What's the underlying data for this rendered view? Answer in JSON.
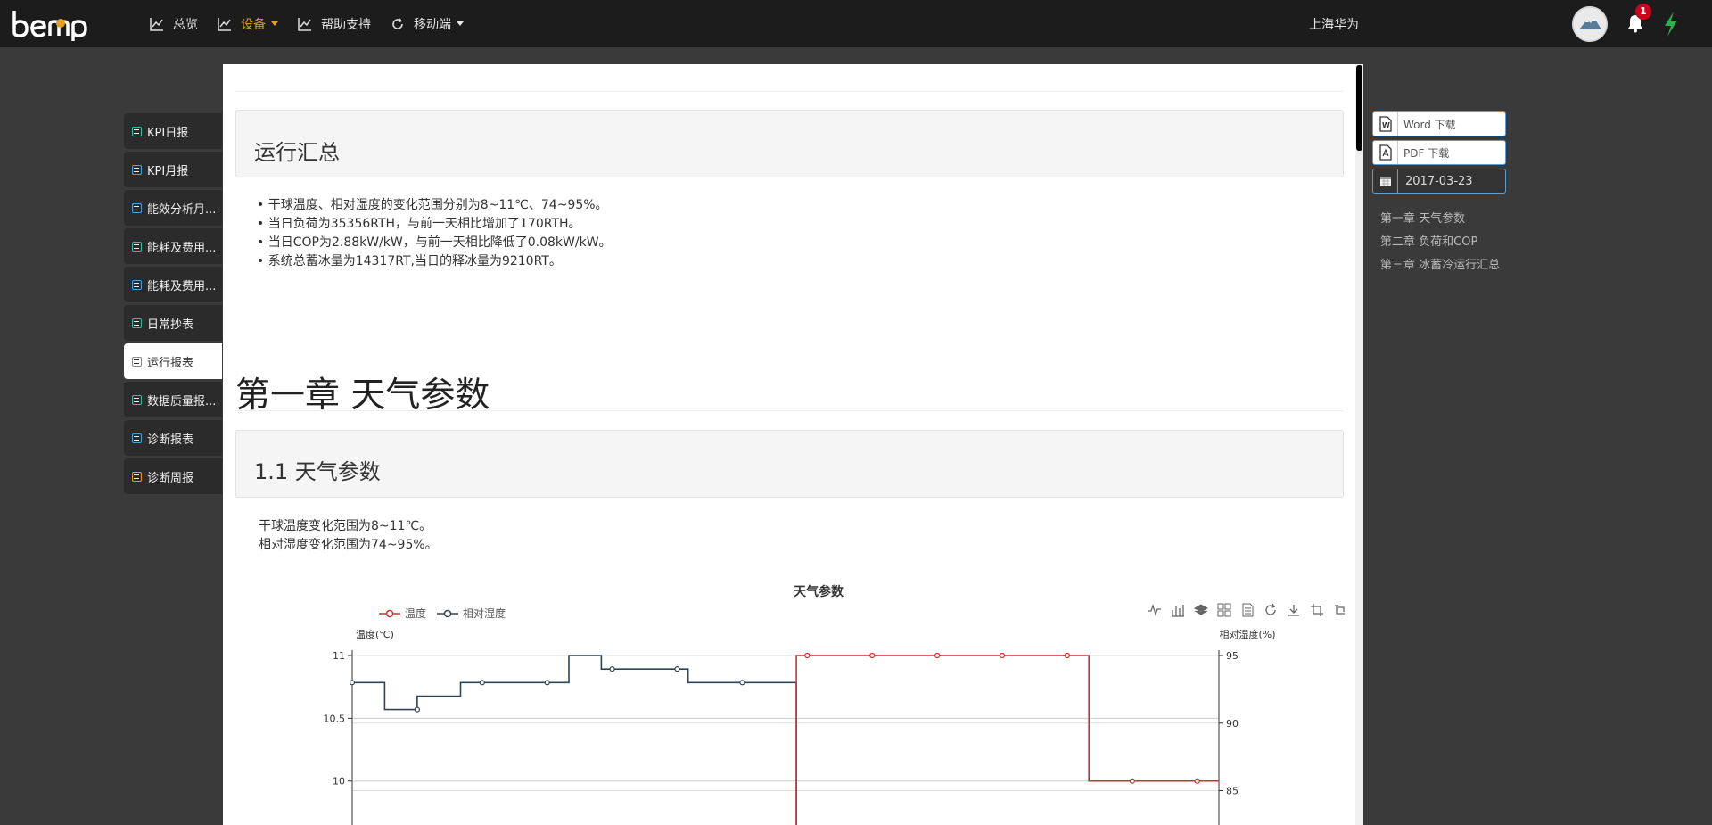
{
  "header": {
    "logo_text": "bemp",
    "nav": [
      {
        "label": "总览",
        "icon": "line-chart-icon",
        "active": false
      },
      {
        "label": "设备",
        "icon": "line-chart-icon",
        "active": true,
        "dropdown": true
      },
      {
        "label": "帮助支持",
        "icon": "line-chart-icon",
        "active": false
      },
      {
        "label": "移动端",
        "icon": "refresh-icon",
        "active": false,
        "dropdown": true
      }
    ],
    "org_name": "上海华为",
    "notification_count": "1"
  },
  "sidebar": {
    "items": [
      {
        "label": "KPI日报",
        "icon": "edit-icon"
      },
      {
        "label": "KPI月报",
        "icon": "list-icon"
      },
      {
        "label": "能效分析月...",
        "icon": "list-icon"
      },
      {
        "label": "能耗及费用...",
        "icon": "edit-icon"
      },
      {
        "label": "能耗及费用...",
        "icon": "list-icon"
      },
      {
        "label": "日常抄表",
        "icon": "edit-icon"
      },
      {
        "label": "运行报表",
        "icon": "edit-icon",
        "active": true
      },
      {
        "label": "数据质量报...",
        "icon": "edit-icon"
      },
      {
        "label": "诊断报表",
        "icon": "list-icon"
      },
      {
        "label": "诊断周报",
        "icon": "check-icon"
      }
    ]
  },
  "report": {
    "summary_title": "运行汇总",
    "summary_bullets": [
      "干球温度、相对湿度的变化范围分别为8~11℃、74~95%。",
      "当日负荷为35356RTH，与前一天相比增加了170RTH。",
      "当日COP为2.88kW/kW，与前一天相比降低了0.08kW/kW。",
      "系统总蓄冰量为14317RT,当日的释冰量为9210RT。"
    ],
    "chapter1_title": "第一章 天气参数",
    "section1_1_title": "1.1 天气参数",
    "section1_1_lines": [
      "干球温度变化范围为8~11℃。",
      "相对湿度变化范围为74~95%。"
    ]
  },
  "chart_data": {
    "type": "line",
    "title": "天气参数",
    "legend": [
      "温度",
      "相对湿度"
    ],
    "ylabel_left": "温度(℃)",
    "ylabel_right": "相对湿度(%)",
    "yticks_left": [
      "11",
      "10.5",
      "10"
    ],
    "yticks_right": [
      "95",
      "90",
      "85"
    ],
    "y_left_range": [
      9.6,
      11
    ],
    "y_right_range": [
      82,
      95
    ],
    "colors": {
      "温度": "#c23531",
      "相对湿度": "#2f4554"
    },
    "series": [
      {
        "name": "相对湿度",
        "points": [
          [
            0,
            93
          ],
          [
            3,
            93
          ],
          [
            3,
            91
          ],
          [
            6,
            91
          ],
          [
            6,
            92
          ],
          [
            10,
            92
          ],
          [
            10,
            93
          ],
          [
            20,
            93
          ],
          [
            20,
            95
          ],
          [
            23,
            95
          ],
          [
            23,
            94
          ],
          [
            31,
            94
          ],
          [
            31,
            93
          ],
          [
            41,
            93
          ],
          [
            41,
            80
          ]
        ]
      },
      {
        "name": "温度",
        "points": [
          [
            41,
            9
          ],
          [
            41,
            11
          ],
          [
            68,
            11
          ],
          [
            68,
            10
          ],
          [
            80,
            10
          ]
        ]
      }
    ],
    "markers": {
      "相对湿度": [
        [
          0,
          93
        ],
        [
          6,
          91
        ],
        [
          12,
          93
        ],
        [
          18,
          93
        ],
        [
          24,
          94
        ],
        [
          30,
          94
        ],
        [
          36,
          93
        ]
      ],
      "温度": [
        [
          42,
          11
        ],
        [
          48,
          11
        ],
        [
          54,
          11
        ],
        [
          60,
          11
        ],
        [
          66,
          11
        ],
        [
          72,
          10
        ],
        [
          78,
          10
        ]
      ]
    }
  },
  "right": {
    "word_label": "Word 下载",
    "pdf_label": "PDF 下载",
    "date": "2017-03-23",
    "toc": [
      "第一章 天气参数",
      "第二章 负荷和COP",
      "第三章 冰蓄冷运行汇总"
    ]
  }
}
